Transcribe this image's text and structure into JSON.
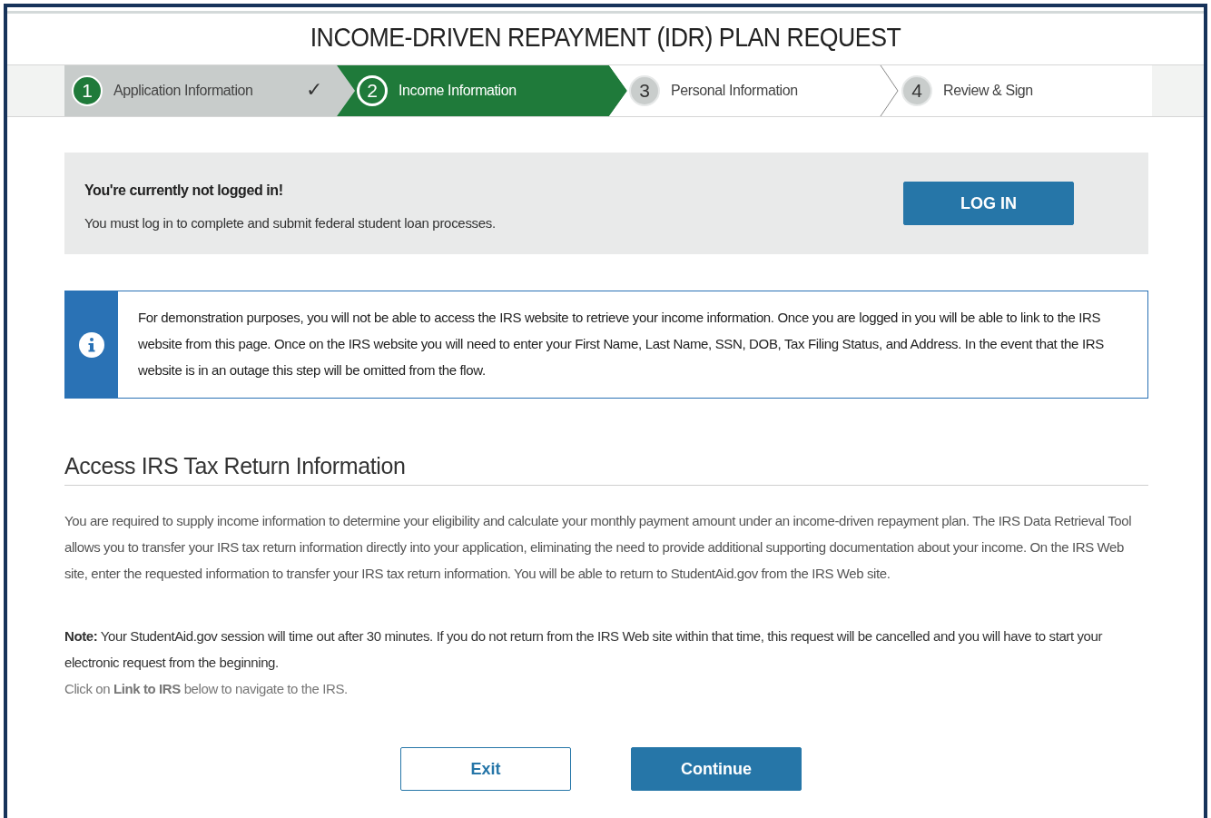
{
  "title": "INCOME-DRIVEN REPAYMENT (IDR) PLAN REQUEST",
  "steps": [
    {
      "number": "1",
      "label": "Application Information",
      "completed": true,
      "selected": false
    },
    {
      "number": "2",
      "label": "Income Information",
      "completed": false,
      "selected": true
    },
    {
      "number": "3",
      "label": "Personal Information",
      "completed": false,
      "selected": false
    },
    {
      "number": "4",
      "label": "Review & Sign",
      "completed": false,
      "selected": false
    }
  ],
  "check_mark": "✓",
  "login": {
    "title": "You're currently not logged in!",
    "text": "You must log in to complete and submit federal student loan processes.",
    "button": "LOG IN"
  },
  "info": {
    "text": "For demonstration purposes, you will not be able to access the IRS website to retrieve your income information. Once you are logged in you will be able to link to the IRS website from this page. Once on the IRS website you will need to enter your First Name, Last Name, SSN, DOB, Tax Filing Status, and Address. In the event that the IRS website is in an outage this step will be omitted from the flow."
  },
  "section": {
    "heading": "Access IRS Tax Return Information",
    "paragraph": "You are required to supply income information to determine your eligibility and calculate your monthly payment amount under an income-driven repayment plan. The IRS Data Retrieval Tool allows you to transfer your IRS tax return information directly into your application, eliminating the need to provide additional supporting documentation about your income. On the IRS Web site, enter the requested information to transfer your IRS tax return information. You will be able to return to StudentAid.gov from the IRS Web site.",
    "note": "**Note:** Your StudentAid.gov session will time out after 30 minutes. If you do not return from the IRS Web site within that time, this request will be cancelled and you will have to start your electronic request from the beginning.",
    "hint": "Click on **Link to IRS** below to navigate to the IRS."
  },
  "buttons": [
    {
      "label": "Exit",
      "kind": "secondary"
    },
    {
      "label": "Continue",
      "kind": "primary"
    }
  ]
}
